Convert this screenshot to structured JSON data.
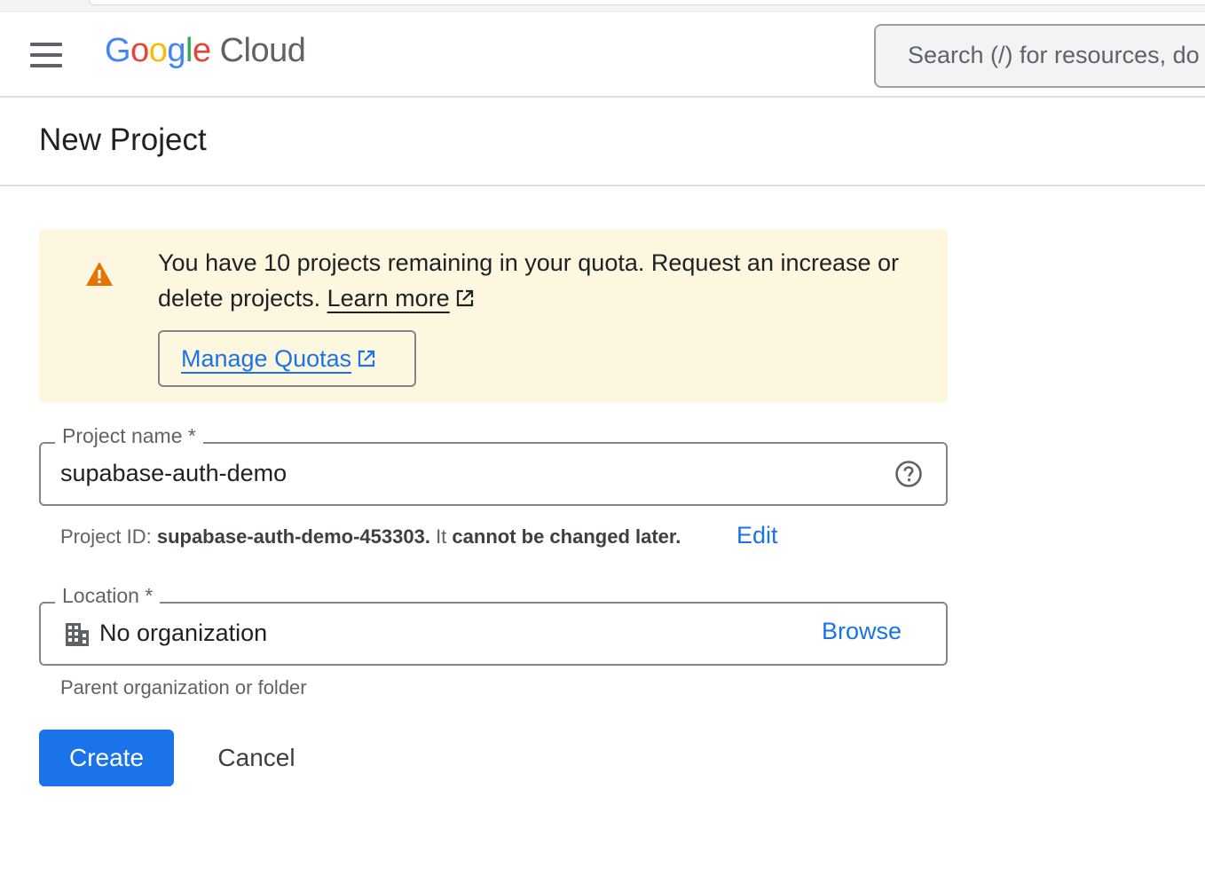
{
  "header": {
    "logo": {
      "letters": [
        "G",
        "o",
        "o",
        "g",
        "l",
        "e"
      ],
      "product": "Cloud"
    },
    "search_placeholder": "Search (/) for resources, do"
  },
  "page": {
    "title": "New Project"
  },
  "quota_banner": {
    "message": "You have 10 projects remaining in your quota. Request an increase or delete projects.",
    "learn_more": "Learn more",
    "manage_quotas": "Manage Quotas"
  },
  "project_name": {
    "label": "Project name *",
    "value": "supabase-auth-demo"
  },
  "project_id": {
    "prefix": "Project ID:",
    "id": "supabase-auth-demo-453303.",
    "middle": "It",
    "note": "cannot be changed later.",
    "edit": "Edit"
  },
  "location": {
    "label": "Location *",
    "value": "No organization",
    "browse": "Browse",
    "helper": "Parent organization or folder"
  },
  "actions": {
    "create": "Create",
    "cancel": "Cancel"
  },
  "colors": {
    "primary": "#1a73e8",
    "warning_bg": "#fef7e0",
    "warning_icon": "#e37400",
    "logo_blue": "#4285f4",
    "logo_red": "#ea4335",
    "logo_yellow": "#fbbc04",
    "logo_green": "#34a853"
  }
}
